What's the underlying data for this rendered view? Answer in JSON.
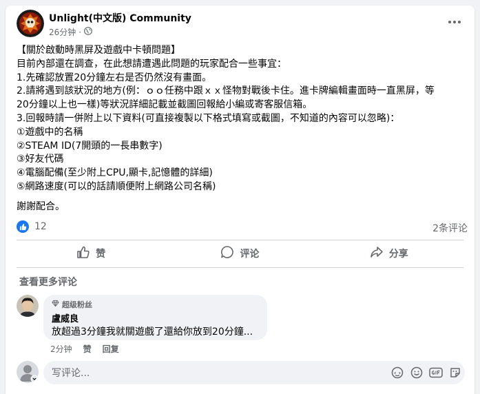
{
  "post": {
    "page_name": "Unlight(中文版) Community",
    "time": "26分钟",
    "separator": "·",
    "privacy_icon": "globe-icon",
    "body_lines": [
      "【關於啟動時黑屏及遊戲中卡頓問題】",
      "目前內部還在調查，在此想請遭遇此問題的玩家配合一些事宜：",
      "1.先確認放置20分鐘左右是否仍然沒有畫面。",
      "2.請將遇到該狀況的地方(例：ｏｏ任務中跟ｘｘ怪物對戰後卡住。進卡牌編輯畫面時一直黑屏，等",
      "20分鐘以上也一樣)等狀況詳細記載並截圖回報給小編或寄客服信箱。",
      "3.回報時請一併附上以下資料(可直接複製以下格式填寫或截圖，不知道的內容可以忽略)：",
      "①遊戲中的名稱",
      "②STEAM ID(7開頭的一長串數字)",
      "③好友代碼",
      "④電腦配備(至少附上CPU,顯卡,記憶體的詳細)",
      "⑤網路速度(可以的話請順便附上網路公司名稱)",
      "",
      "謝謝配合。"
    ],
    "reaction_count": "12",
    "comment_count": "2条评论"
  },
  "actions": {
    "like": "赞",
    "comment": "评论",
    "share": "分享"
  },
  "comments": {
    "view_more": "查看更多评论",
    "items": [
      {
        "badge": "超级粉丝",
        "author": "盧威良",
        "text": "放超過3分鐘我就關遊戲了還給你放到20分鐘...",
        "time": "2分钟",
        "like": "赞",
        "reply": "回复"
      }
    ]
  },
  "composer": {
    "placeholder": "写评论...",
    "tools": [
      "sticker-icon",
      "emoji-icon",
      "gif-icon",
      "sticker-face-icon"
    ]
  },
  "colors": {
    "accent": "#1877f2",
    "text": "#050505",
    "secondary": "#65676b",
    "background": "#f0f2f5"
  }
}
